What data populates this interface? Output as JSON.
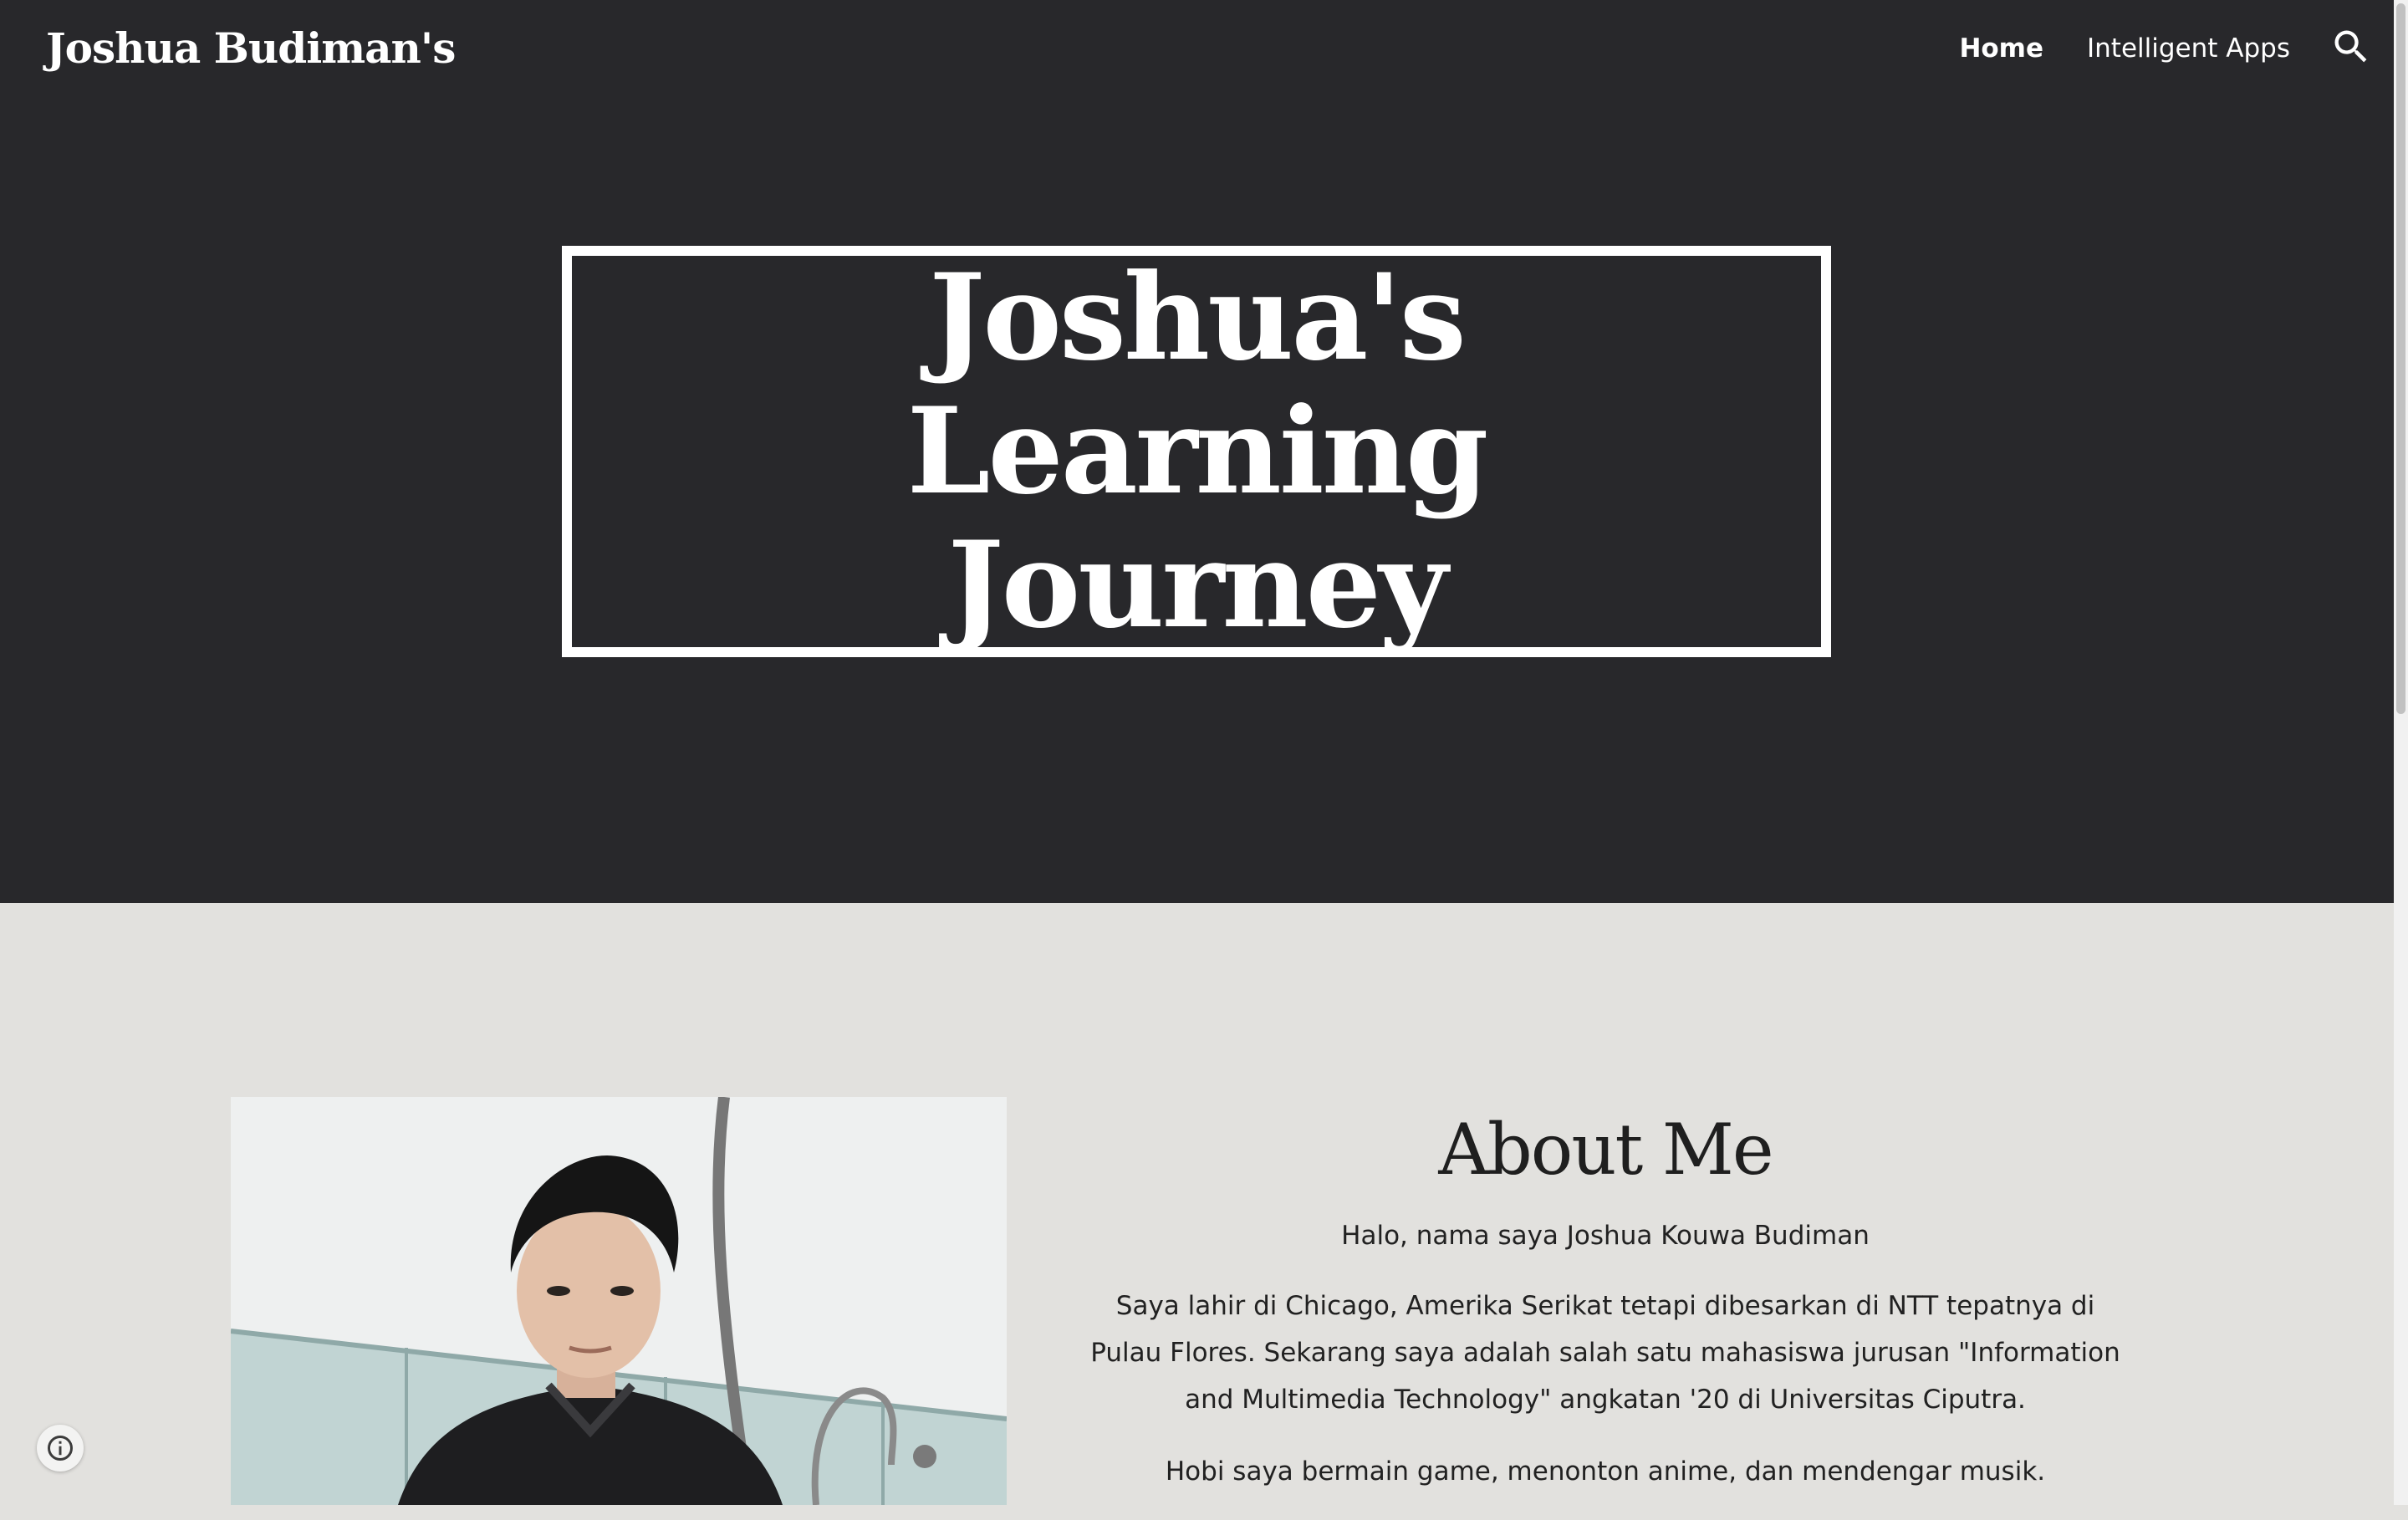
{
  "header": {
    "site_title": "Joshua Budiman's",
    "nav": [
      {
        "label": "Home",
        "active": true
      },
      {
        "label": "Intelligent Apps",
        "active": false
      }
    ],
    "search_icon": "search-icon"
  },
  "hero": {
    "title": "Joshua's Learning Journey"
  },
  "about": {
    "heading": "About Me",
    "paragraphs": [
      "Halo, nama saya Joshua Kouwa Budiman",
      "Saya lahir di Chicago, Amerika Serikat tetapi dibesarkan di NTT tepatnya di Pulau Flores. Sekarang saya adalah salah satu mahasiswa jurusan \"Information and Multimedia Technology\" angkatan '20 di Universitas Ciputra.",
      "Hobi saya bermain game, menonton anime, dan mendengar musik."
    ]
  },
  "info_icon": "info-icon",
  "colors": {
    "hero_bg": "#28282b",
    "page_bg": "#e2e1de",
    "text_light": "#ffffff",
    "text_dark": "#212121"
  }
}
